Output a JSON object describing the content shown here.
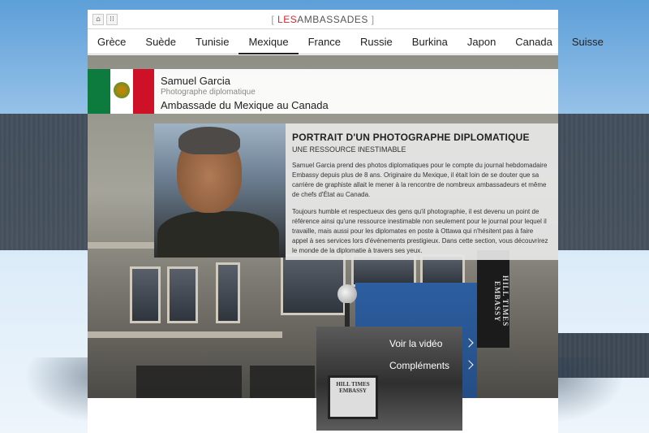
{
  "topbar": {
    "home_icon": "home-icon",
    "grid_icon": "grid-icon",
    "brand_open": "[",
    "brand_les": "LES",
    "brand_name": "AMBASSADES",
    "brand_close": "]"
  },
  "nav": {
    "items": [
      "Grèce",
      "Suède",
      "Tunisie",
      "Mexique",
      "France",
      "Russie",
      "Burkina",
      "Japon",
      "Canada",
      "Suisse"
    ],
    "active": "Mexique"
  },
  "profile": {
    "name": "Samuel Garcia",
    "role": "Photographe diplomatique",
    "embassy": "Ambassade du Mexique au Canada",
    "flag_colors": [
      "#0d7a3e",
      "#ffffff",
      "#ce1126"
    ]
  },
  "article": {
    "title": "PORTRAIT D'UN PHOTOGRAPHE DIPLOMATIQUE",
    "subtitle": "UNE RESSOURCE INESTIMABLE",
    "paragraph1": "Samuel Garcia prend des photos diplomatiques pour le compte du journal hebdomadaire Embassy depuis plus de 8 ans. Originaire du Mexique, il était loin de se douter que sa carrière de graphiste allait le mener à la rencontre de nombreux ambassadeurs et même de chefs d'État au Canada.",
    "paragraph2": "Toujours humble et respectueux des gens qu'il photographie, il est devenu un point de référence ainsi qu'une ressource inestimable non seulement pour le journal pour lequel il travaille, mais aussi pour les diplomates en poste à Ottawa qui n'hésitent pas à faire appel à ses services lors d'événements prestigieux. Dans cette section, vous découvrirez le monde de la diplomatie à travers ses yeux."
  },
  "links": {
    "video": "Voir la vidéo",
    "extras": "Compléments"
  },
  "banner_text": "HILL TIMES EMBASSY"
}
